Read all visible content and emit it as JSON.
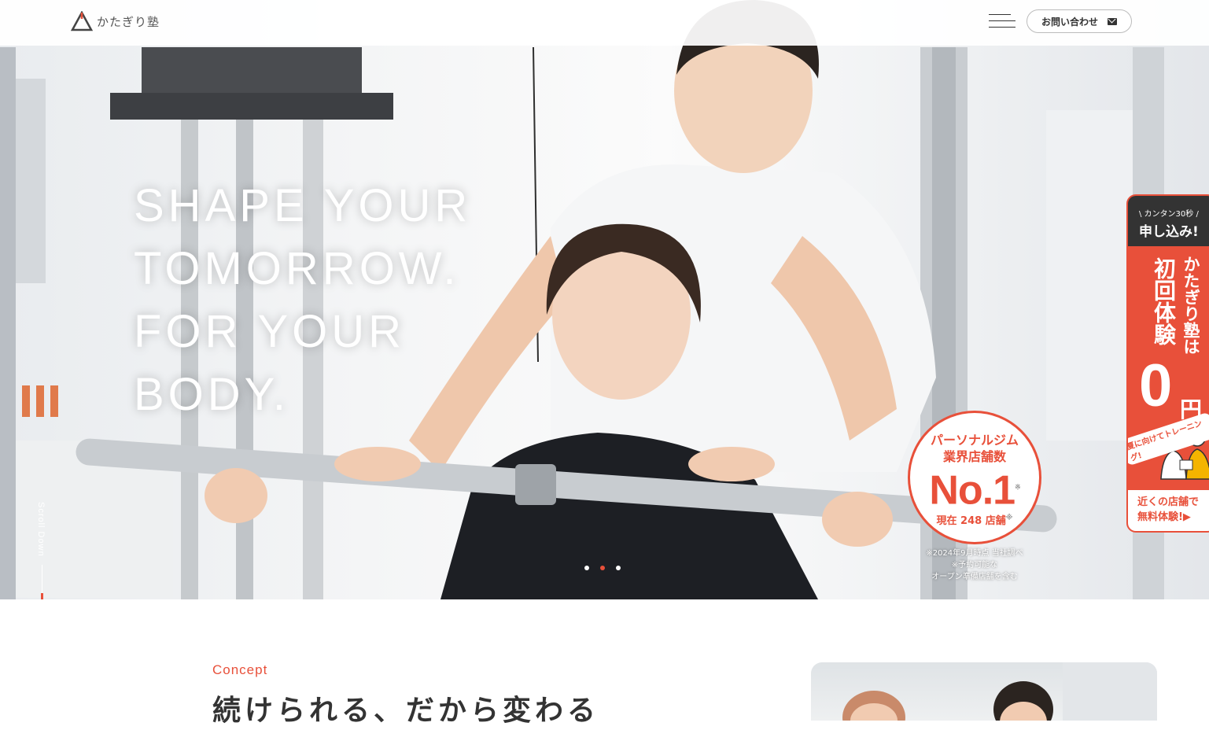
{
  "header": {
    "logo_text": "かたぎり塾",
    "menu_icon": "hamburger-icon",
    "contact_label": "お問い合わせ",
    "contact_icon": "mail-icon"
  },
  "hero": {
    "headline": [
      "SHAPE YOUR",
      "TOMORROW.",
      "FOR YOUR",
      "BODY."
    ],
    "scroll_label": "Scroll Down",
    "slider_dots": 3,
    "active_dot": 2,
    "badge": {
      "line1": "パーソナルジム",
      "line2": "業界店舗数",
      "rank": "No.1",
      "count": "現在 248 店舗",
      "mark": "※"
    },
    "badge_note": [
      "※2024年9月時点 当社調べ",
      "※予約可能な",
      "オープン準備店舗を含む"
    ]
  },
  "trial_tab": {
    "small": "\\ カンタン30秒 /",
    "big": "申し込み!",
    "vertical1": "初回体験",
    "vertical2": "かたぎり塾は",
    "price": "0",
    "currency": "円",
    "summer": "夏に向けてトレーニング!",
    "cta_line1": "近くの店舗で",
    "cta_line2": "無料体験!▶"
  },
  "concept": {
    "label": "Concept",
    "title": "続けられる、だから変わる"
  },
  "colors": {
    "accent": "#e8503a",
    "dark": "#333333"
  }
}
